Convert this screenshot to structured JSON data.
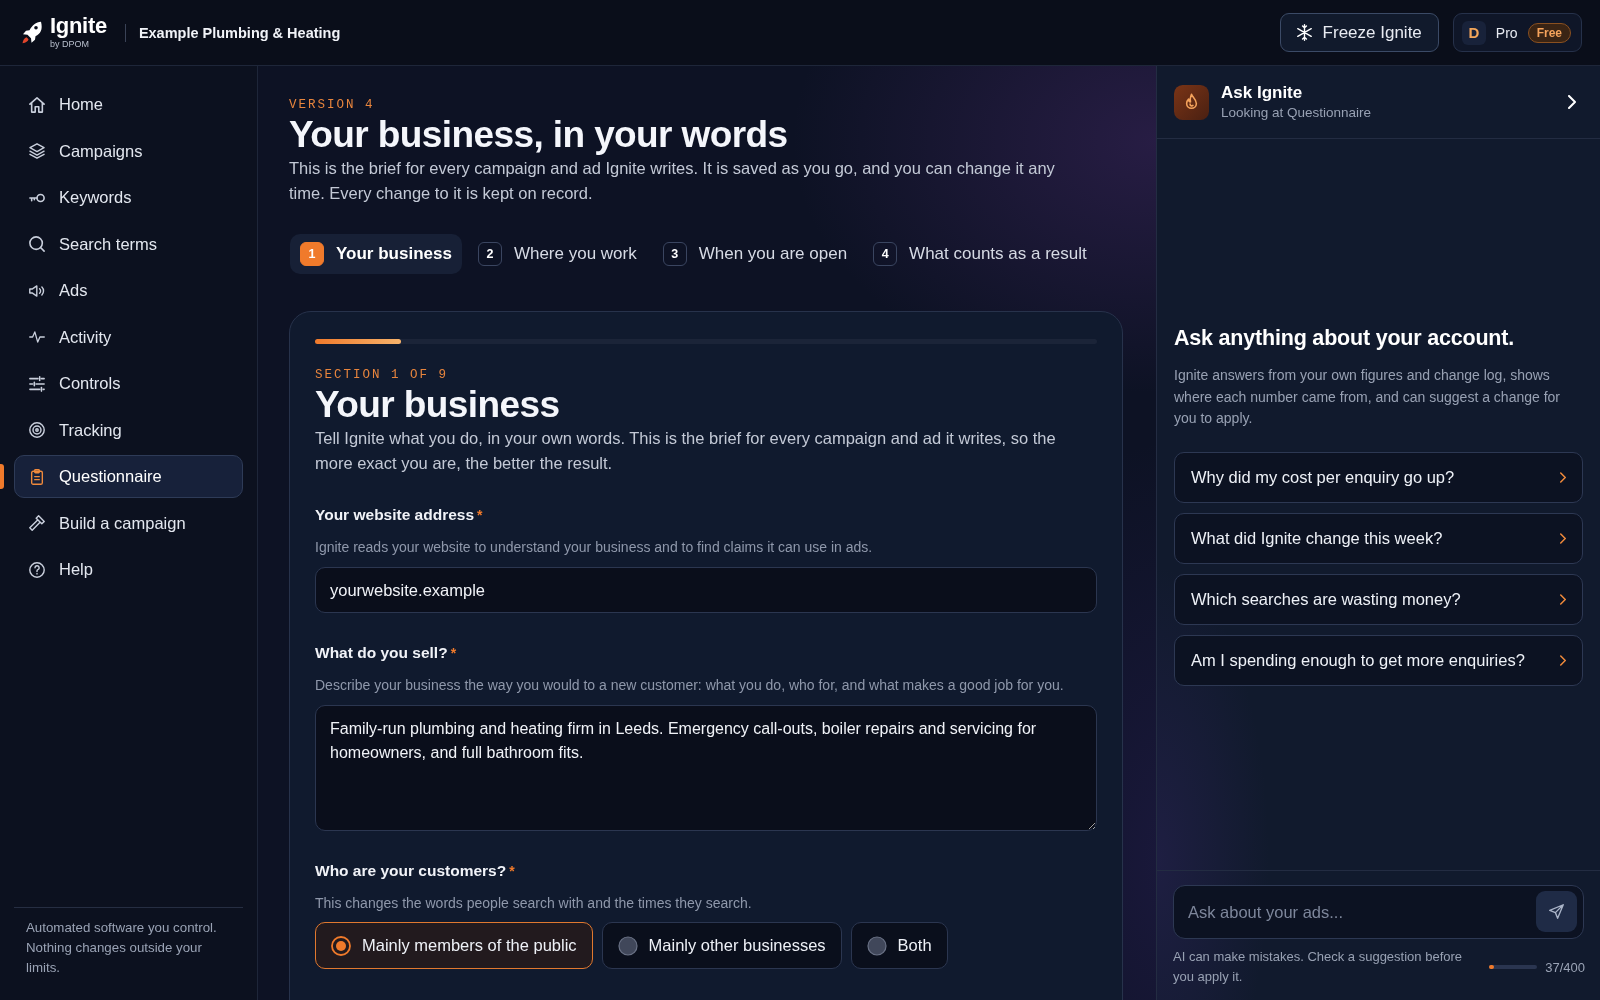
{
  "topbar": {
    "brand": "Ignite",
    "tagline": "by DPOM",
    "workspace": "Example Plumbing & Heating",
    "freeze_button": "Freeze Ignite",
    "account": {
      "initial": "D",
      "plan": "Pro",
      "badge": "Free"
    }
  },
  "sidebar": {
    "items": [
      {
        "label": "Home",
        "selected": false
      },
      {
        "label": "Campaigns",
        "selected": false
      },
      {
        "label": "Keywords",
        "selected": false
      },
      {
        "label": "Search terms",
        "selected": false
      },
      {
        "label": "Ads",
        "selected": false
      },
      {
        "label": "Activity",
        "selected": false
      },
      {
        "label": "Controls",
        "selected": false
      },
      {
        "label": "Tracking",
        "selected": false
      },
      {
        "label": "Questionnaire",
        "selected": true
      },
      {
        "label": "Build a campaign",
        "selected": false
      },
      {
        "label": "Help",
        "selected": false
      }
    ],
    "footer": "Automated software you control. Nothing changes outside your limits."
  },
  "header": {
    "eyebrow": "VERSION 4",
    "title": "Your business, in your words",
    "intro": "This is the brief for every campaign and ad Ignite writes. It is saved as you go, and you can change it any time. Every change to it is kept on record."
  },
  "steps": [
    {
      "number": "1",
      "label": "Your business",
      "selected": true
    },
    {
      "number": "2",
      "label": "Where you work",
      "selected": false
    },
    {
      "number": "3",
      "label": "When you are open",
      "selected": false
    },
    {
      "number": "4",
      "label": "What counts as a result",
      "selected": false
    }
  ],
  "section": {
    "level": 0.11,
    "eyebrow": "SECTION 1 OF 9",
    "title": "Your business",
    "intro": "Tell Ignite what you do, in your own words. This is the brief for every campaign and ad it writes, so the more exact you are, the better the result.",
    "fields": [
      {
        "kind": "text",
        "label": "Your website address",
        "required_mark": "*",
        "help": "Ignite reads your website to understand your business and to find claims it can use in ads.",
        "value": "yourwebsite.example"
      },
      {
        "kind": "textarea",
        "label": "What do you sell?",
        "required_mark": "*",
        "help": "Describe your business the way you would to a new customer: what you do, who for, and what makes a good job for you.",
        "value": "Family-run plumbing and heating firm in Leeds. Emergency call-outs, boiler repairs and servicing for homeowners, and full bathroom fits."
      },
      {
        "kind": "choice",
        "label": "Who are your customers?",
        "required_mark": "*",
        "help": "This changes the words people search with and the times they search.",
        "options": [
          {
            "label": "Mainly members of the public",
            "selected": true
          },
          {
            "label": "Mainly other businesses",
            "selected": false
          },
          {
            "label": "Both",
            "selected": false
          }
        ]
      }
    ]
  },
  "assistant": {
    "title": "Ask Ignite",
    "subtitle": "Looking at Questionnaire",
    "heading": "Ask anything about your account.",
    "intro": "Ignite answers from your own figures and change log, shows where each number came from, and can suggest a change for you to apply.",
    "suggestions": [
      "Why did my cost per enquiry go up?",
      "What did Ignite change this week?",
      "Which searches are wasting money?",
      "Am I spending enough to get more enquiries?"
    ],
    "input": {
      "placeholder": "Ask about your ads..."
    },
    "disclaimer": "AI can make mistakes. Check a suggestion before you apply it.",
    "counter": {
      "level": 0.09,
      "reading": "37/400"
    }
  }
}
